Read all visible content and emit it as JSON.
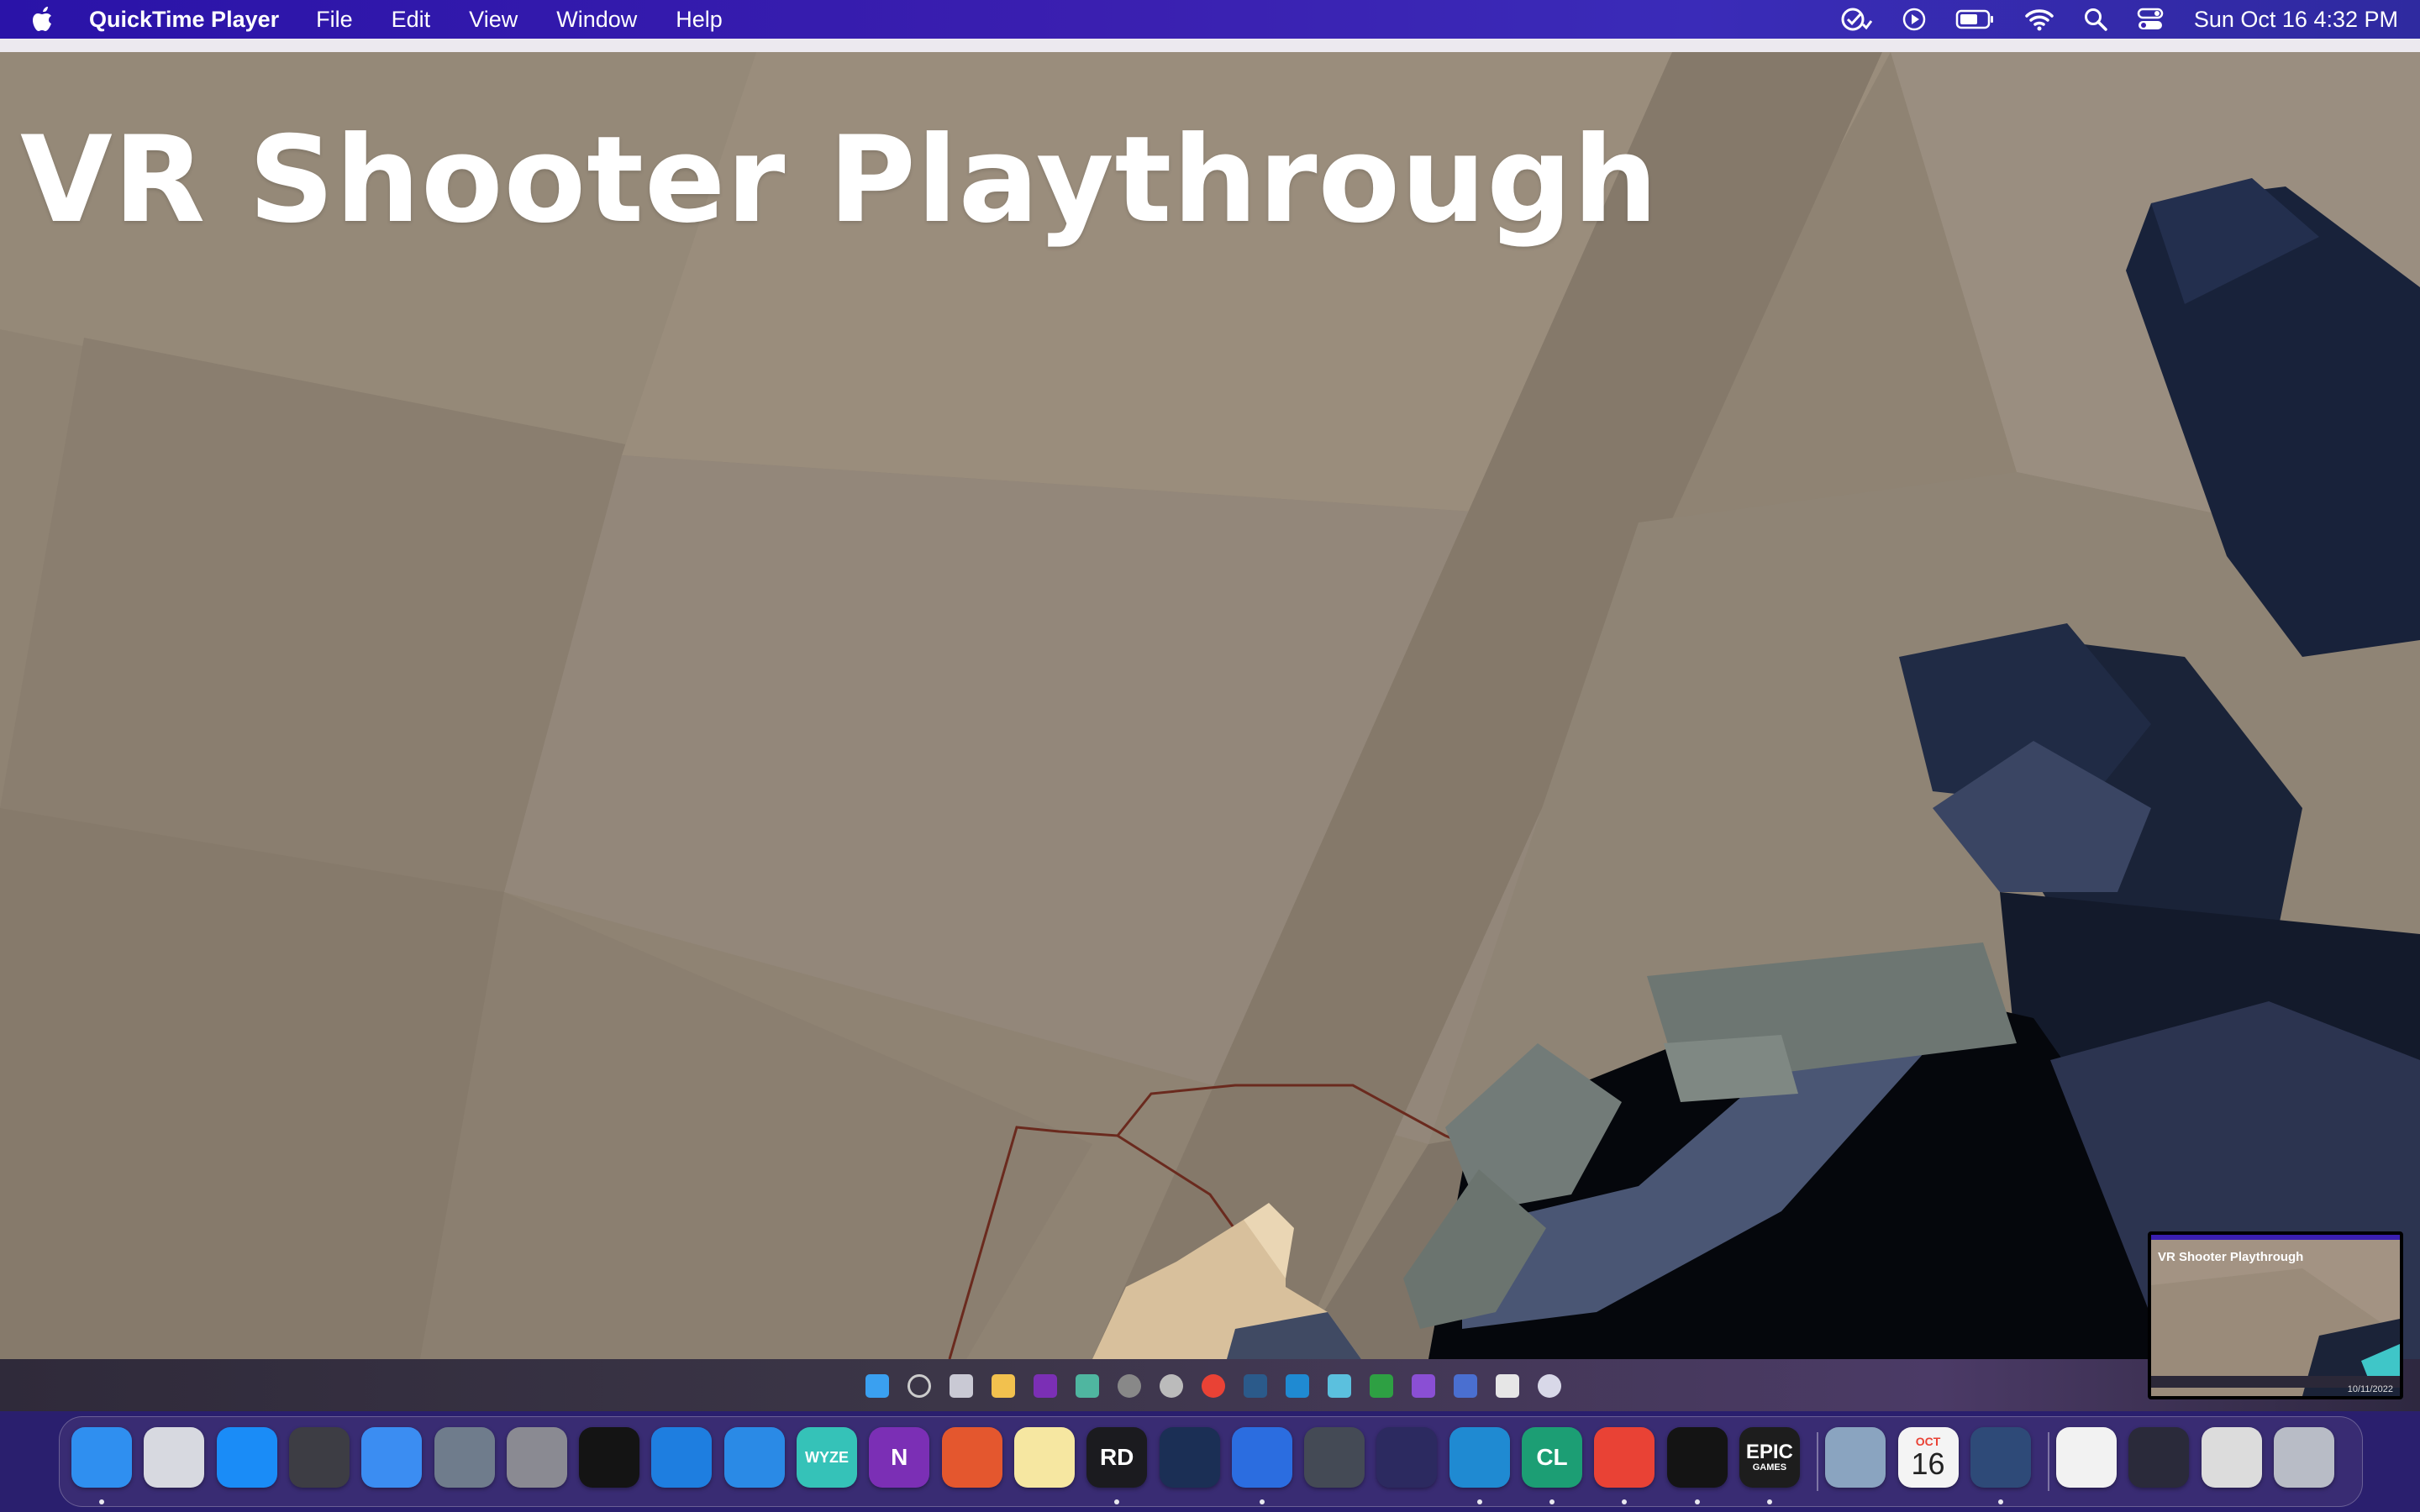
{
  "menubar": {
    "app_name": "QuickTime Player",
    "menus": [
      "File",
      "Edit",
      "View",
      "Window",
      "Help"
    ],
    "clock": "Sun Oct 16  4:32 PM",
    "status_icons": [
      "checklist-icon",
      "play-circle-icon",
      "battery-icon",
      "wifi-icon",
      "search-icon",
      "control-center-icon"
    ]
  },
  "video": {
    "title": "VR Shooter Playthrough"
  },
  "pip": {
    "title": "VR Shooter Playthrough",
    "date": "10/11/2022"
  },
  "dock": {
    "apps": [
      {
        "name": "finder-icon",
        "color": "#2f8ff0",
        "label": ""
      },
      {
        "name": "launchpad-icon",
        "color": "#d7d9e0",
        "label": ""
      },
      {
        "name": "app-store-icon",
        "color": "#1a8cf7",
        "label": ""
      },
      {
        "name": "disk-utility-icon",
        "color": "#3d3d44",
        "label": ""
      },
      {
        "name": "swift-playgrounds-icon",
        "color": "#3b8df2",
        "label": ""
      },
      {
        "name": "preview-icon",
        "color": "#6f7c8c",
        "label": ""
      },
      {
        "name": "system-preferences-icon",
        "color": "#8a8a92",
        "label": ""
      },
      {
        "name": "terminal-icon",
        "color": "#141414",
        "label": ""
      },
      {
        "name": "xcode-icon",
        "color": "#1e7ee0",
        "label": ""
      },
      {
        "name": "instruments-icon",
        "color": "#2a8ae6",
        "label": ""
      },
      {
        "name": "wyze-icon",
        "color": "#35c2b8",
        "label": "WYZE"
      },
      {
        "name": "onenote-icon",
        "color": "#7b2fb5",
        "label": "N"
      },
      {
        "name": "remote-desktop-icon",
        "color": "#e4572e",
        "label": ""
      },
      {
        "name": "notes-icon",
        "color": "#f6e7a1",
        "label": ""
      },
      {
        "name": "rider-icon",
        "color": "#1b1b1f",
        "label": "RD"
      },
      {
        "name": "steam-icon",
        "color": "#1b2f55",
        "label": ""
      },
      {
        "name": "xcode-cloud-icon",
        "color": "#2b6de0",
        "label": ""
      },
      {
        "name": "unity-icon",
        "color": "#444a55",
        "label": ""
      },
      {
        "name": "eclipse-icon",
        "color": "#2c2a60",
        "label": ""
      },
      {
        "name": "vscode-icon",
        "color": "#1f8ad2",
        "label": ""
      },
      {
        "name": "clion-icon",
        "color": "#1c9e74",
        "label": "CL"
      },
      {
        "name": "chrome-icon",
        "color": "#e94235",
        "label": ""
      },
      {
        "name": "terminal-2-icon",
        "color": "#141414",
        "label": ""
      },
      {
        "name": "epic-games-icon",
        "color": "#1d1d1d",
        "label": "EPIC"
      },
      {
        "name": "photo-icon",
        "color": "#8aa4c0",
        "label": ""
      },
      {
        "name": "calendar-icon",
        "color": "#f4f4f4",
        "label": "16"
      },
      {
        "name": "quicktime-icon",
        "color": "#2e4a78",
        "label": ""
      },
      {
        "name": "html-document-icon",
        "color": "#f2f2f2",
        "label": ""
      },
      {
        "name": "screenshot-thumb-icon",
        "color": "#2a2a3a",
        "label": ""
      },
      {
        "name": "window-thumb-icon",
        "color": "#dcdcdc",
        "label": ""
      },
      {
        "name": "trash-icon",
        "color": "#b8bcc6",
        "label": ""
      }
    ],
    "calendar_month": "OCT",
    "epic_sub": "GAMES"
  }
}
